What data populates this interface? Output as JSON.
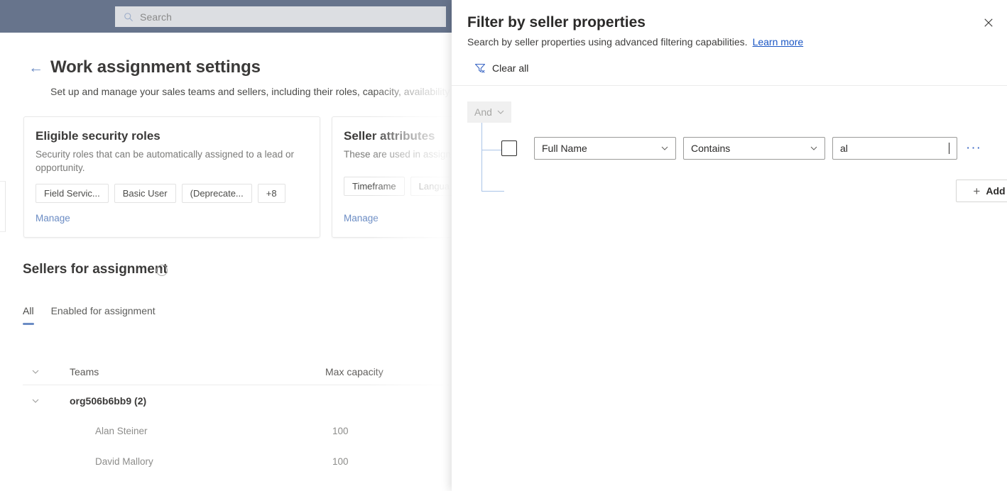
{
  "top_bar": {
    "search": {
      "placeholder": "Search",
      "icon": "search-icon"
    }
  },
  "page": {
    "back_icon": "back-arrow-icon",
    "title": "Work assignment settings",
    "subtitle": "Set up and manage your sales teams and sellers, including their roles, capacity, availability a"
  },
  "cards": [
    {
      "title": "Eligible security roles",
      "description": "Security roles that can be automatically assigned to a lead or opportunity.",
      "pills": [
        "Field Servic...",
        "Basic User",
        "(Deprecate...",
        "+8"
      ],
      "manage_label": "Manage"
    },
    {
      "title": "Seller attributes",
      "description": "These are used in assignm",
      "pills": [
        "Timeframe",
        "Langua"
      ],
      "manage_label": "Manage"
    }
  ],
  "sellers": {
    "heading": "Sellers for assignment",
    "info_icon": "info-icon",
    "tabs": [
      {
        "label": "All",
        "selected": true
      },
      {
        "label": "Enabled for assignment",
        "selected": false
      }
    ],
    "table": {
      "columns": [
        "Teams",
        "Max capacity"
      ],
      "rows": [
        {
          "type": "group",
          "teams": "org506b6bb9 (2)",
          "capacity": ""
        },
        {
          "type": "seller",
          "teams": "Alan Steiner",
          "capacity": "100"
        },
        {
          "type": "seller",
          "teams": "David Mallory",
          "capacity": "100"
        }
      ]
    }
  },
  "panel": {
    "title": "Filter by seller properties",
    "close_icon": "close-icon",
    "subtitle": "Search by seller properties using advanced filtering capabilities.",
    "learn_more_label": "Learn more",
    "clear_all": {
      "label": "Clear all",
      "icon": "clear-filter-icon"
    },
    "connector": {
      "label": "And",
      "chevron_icon": "chevron-down-icon"
    },
    "filter_row": {
      "checkbox_checked": false,
      "attribute": "Full Name",
      "operator": "Contains",
      "value": "al",
      "overflow_label": "···"
    },
    "add_button": {
      "label": "Add",
      "plus_icon": "plus-icon",
      "chevron_icon": "chevron-down-icon"
    }
  },
  "colors": {
    "top_bar": "#67748c",
    "accent_blue": "#6b8cc4",
    "link_blue": "#1a56c4",
    "tree_line": "#aac4e8",
    "overflow_blue": "#3a66c4"
  }
}
